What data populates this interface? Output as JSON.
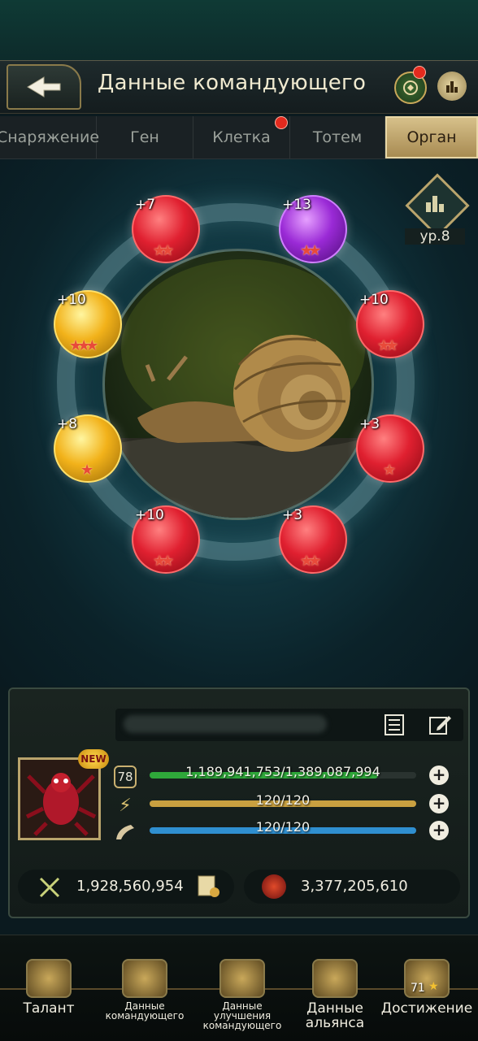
{
  "header": {
    "title": "Данные командующего"
  },
  "tabs": [
    {
      "label": "Снаряжение",
      "active": false,
      "dot": false
    },
    {
      "label": "Ген",
      "active": false,
      "dot": false
    },
    {
      "label": "Клетка",
      "active": false,
      "dot": true
    },
    {
      "label": "Тотем",
      "active": false,
      "dot": false
    },
    {
      "label": "Орган",
      "active": true,
      "dot": false
    }
  ],
  "level_badge": {
    "label": "ур.8"
  },
  "organs": [
    {
      "level": "+7",
      "color": "red",
      "stars": 2
    },
    {
      "level": "+13",
      "color": "purple",
      "stars": 2
    },
    {
      "level": "+10",
      "color": "gold",
      "stars": 3
    },
    {
      "level": "+10",
      "color": "red",
      "stars": 2
    },
    {
      "level": "+8",
      "color": "gold",
      "stars": 1
    },
    {
      "level": "+3",
      "color": "red",
      "stars": 1
    },
    {
      "level": "+10",
      "color": "red",
      "stars": 2
    },
    {
      "level": "+3",
      "color": "red",
      "stars": 2
    }
  ],
  "commander": {
    "new_badge": "NEW",
    "level": "78",
    "hp": {
      "text": "1,189,941,753/1,389,087,994",
      "fraction": 0.857,
      "color": "#2fa83a"
    },
    "energy": {
      "text": "120/120",
      "fraction": 1.0,
      "color": "#c9a040"
    },
    "stamina": {
      "text": "120/120",
      "fraction": 1.0,
      "color": "#2f8fd0"
    },
    "power": "1,928,560,954",
    "kills": "3,377,205,610"
  },
  "nav": [
    {
      "label": "Талант",
      "small": false
    },
    {
      "label": "Данные командующего",
      "small": true
    },
    {
      "label": "Данные улучшения командующего",
      "small": true
    },
    {
      "label": "Данные альянса",
      "small": false
    },
    {
      "label": "Достижение",
      "small": false,
      "badge": "71"
    }
  ]
}
